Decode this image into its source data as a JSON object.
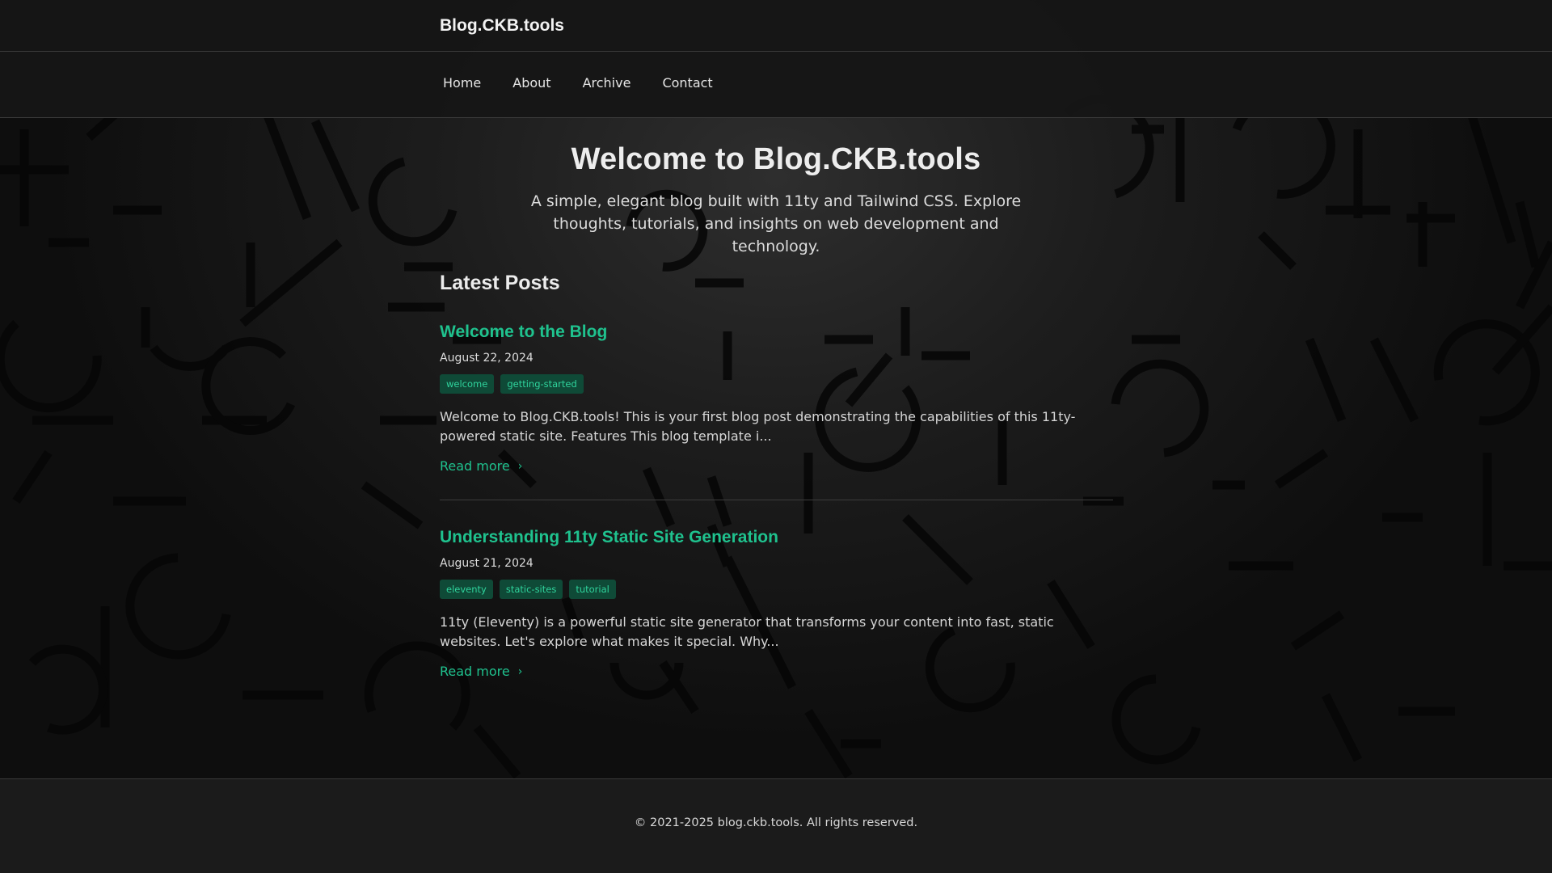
{
  "site": {
    "brand": "Blog.CKB.tools",
    "nav": [
      "Home",
      "About",
      "Archive",
      "Contact"
    ]
  },
  "hero": {
    "title": "Welcome to Blog.CKB.tools",
    "subtitle": "A simple, elegant blog built with 11ty and Tailwind CSS. Explore thoughts, tutorials, and insights on web development and technology."
  },
  "latest": {
    "heading": "Latest Posts",
    "posts": [
      {
        "title": "Welcome to the Blog",
        "date": "August 22, 2024",
        "tags": [
          "welcome",
          "getting-started"
        ],
        "excerpt": "Welcome to Blog.CKB.tools! This is your first blog post demonstrating the capabilities of this 11ty-powered static site. Features This blog template i...",
        "read_more": "Read more"
      },
      {
        "title": "Understanding 11ty Static Site Generation",
        "date": "August 21, 2024",
        "tags": [
          "eleventy",
          "static-sites",
          "tutorial"
        ],
        "excerpt": "11ty (Eleventy) is a powerful static site generator that transforms your content into fast, static websites. Let's explore what makes it special. Why...",
        "read_more": "Read more"
      }
    ]
  },
  "footer": {
    "copyright": "© 2021-2025 blog.ckb.tools. All rights reserved."
  },
  "colors": {
    "accent": "#1fc28e",
    "tag_bg": "#0f4a37",
    "background": "#0d0d0d"
  },
  "icons": {
    "read_more": "chevron-right-icon"
  }
}
